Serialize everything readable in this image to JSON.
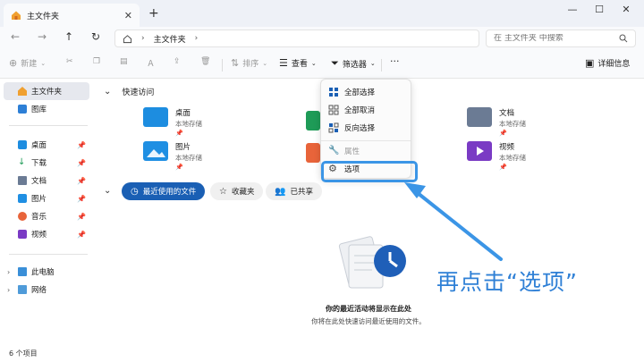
{
  "window": {
    "tab_title": "主文件夹",
    "tab_close": "✕",
    "new_tab": "+",
    "minimize": "—",
    "maximize": "☐",
    "close": "✕"
  },
  "address": {
    "back": "←",
    "forward": "→",
    "up": "↑",
    "refresh": "↻",
    "location": "主文件夹",
    "separator": "›",
    "search_placeholder": "在 主文件夹 中搜索"
  },
  "toolbar": {
    "new_label": "新建",
    "sort_label": "排序",
    "view_label": "查看",
    "filter_label": "筛选器",
    "more_label": "···",
    "details_label": "详细信息"
  },
  "sidebar": {
    "items": [
      {
        "label": "主文件夹"
      },
      {
        "label": "图库"
      },
      {
        "label": "桌面"
      },
      {
        "label": "下载"
      },
      {
        "label": "文档"
      },
      {
        "label": "图片"
      },
      {
        "label": "音乐"
      },
      {
        "label": "视频"
      },
      {
        "label": "此电脑"
      },
      {
        "label": "网络"
      }
    ]
  },
  "quick_access": {
    "header": "快速访问",
    "items": [
      {
        "name": "桌面",
        "sub": "本地存储",
        "color": "#1d8de0"
      },
      {
        "name": "图片",
        "sub": "本地存储",
        "color": "#1f8fe3"
      },
      {
        "name": "文档",
        "sub": "本地存储",
        "color": "#6b7b94"
      },
      {
        "name": "视频",
        "sub": "本地存储",
        "color": "#7a3bc4"
      }
    ]
  },
  "recent": {
    "chip_recent": "最近使用的文件",
    "chip_favorites": "收藏夹",
    "chip_shared": "已共享",
    "empty_title": "你的最近活动将显示在此处",
    "empty_sub": "你将在此处快速访问最近使用的文件。"
  },
  "menu": {
    "select_all": "全部选择",
    "select_none": "全部取消",
    "invert": "反向选择",
    "properties": "属性",
    "options": "选项"
  },
  "status": {
    "count": "6 个项目"
  },
  "annotation": {
    "text": "再点击“选项”",
    "color": "#2f80d6"
  }
}
